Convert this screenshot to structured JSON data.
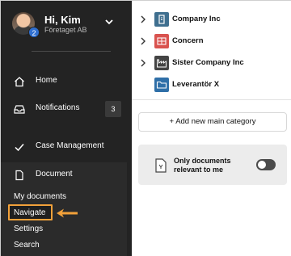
{
  "profile": {
    "greeting": "Hi, Kim",
    "company": "Företaget AB",
    "badge": "2"
  },
  "nav": {
    "home": "Home",
    "notifications": "Notifications",
    "notifications_count": "3",
    "case_management": "Case Management",
    "document": "Document"
  },
  "document_submenu": {
    "items": [
      "My documents",
      "Navigate",
      "Settings",
      "Search"
    ],
    "highlighted": "Navigate"
  },
  "tree": {
    "items": [
      {
        "label": "Company Inc",
        "icon": "building-icon",
        "color": "#3f6f8f"
      },
      {
        "label": "Concern",
        "icon": "grid-icon",
        "color": "#d9534f"
      },
      {
        "label": "Sister Company Inc",
        "icon": "factory-icon",
        "color": "#444444"
      },
      {
        "label": "Leverantör X",
        "icon": "folder-icon",
        "color": "#2f6fa8"
      }
    ]
  },
  "add_category": {
    "label": "Add new main category"
  },
  "filter": {
    "label": "Only documents relevant to me",
    "enabled": false
  },
  "colors": {
    "sidebar_bg": "#232323",
    "highlight": "#f2a13a",
    "accent_blue": "#2f6fd0"
  }
}
